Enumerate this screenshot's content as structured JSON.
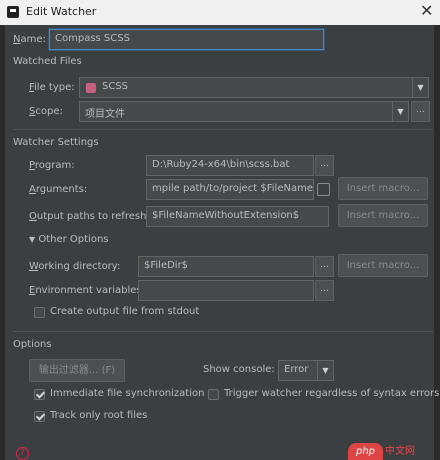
{
  "window": {
    "title": "Edit Watcher",
    "close_glyph": "✕"
  },
  "name": {
    "label_u": "N",
    "label_rest": "ame:",
    "value": "Compass SCSS"
  },
  "watched_files": {
    "heading": "Watched Files",
    "file_type": {
      "label_u": "F",
      "label_rest": "ile type:",
      "value": "SCSS"
    },
    "scope": {
      "label_u": "S",
      "label_rest": "cope:",
      "value": "项目文件"
    }
  },
  "watcher_settings": {
    "heading": "Watcher Settings",
    "program": {
      "label_u": "P",
      "label_rest": "rogram:",
      "value": "D:\\Ruby24-x64\\bin\\scss.bat"
    },
    "arguments": {
      "label_u": "A",
      "label_rest": "rguments:",
      "value": "mpile path/to/project $FileName$"
    },
    "output": {
      "label_u": "O",
      "label_rest": "utput paths to refresh:",
      "value": "$FileNameWithoutExtension$"
    },
    "other_options": "Other Options",
    "working_dir": {
      "label_u": "W",
      "label_rest": "orking directory:",
      "value": "$FileDir$"
    },
    "env_vars": {
      "label_u": "E",
      "label_rest": "nvironment variables:",
      "value": ""
    },
    "create_output": {
      "label": "Create output file from stdout",
      "checked": false
    },
    "insert_macro": "Insert macro...",
    "dots": "..."
  },
  "options": {
    "heading": "Options",
    "output_filters": "输出过滤器... (F)",
    "show_console_label": "Show console:",
    "show_console_value": "Error",
    "immediate_sync": {
      "label": "Immediate file synchronization",
      "checked": true
    },
    "trigger_watcher": {
      "label": "Trigger watcher regardless of syntax errors",
      "checked": false
    },
    "track_root": {
      "label": "Track only root files",
      "checked": true
    }
  },
  "footer": {
    "help_glyph": "?",
    "brand": "php",
    "brand_suffix": "中文网"
  },
  "colors": {
    "accent": "#4a88c7",
    "background": "#3c3f41",
    "scss": "#c7627e"
  }
}
